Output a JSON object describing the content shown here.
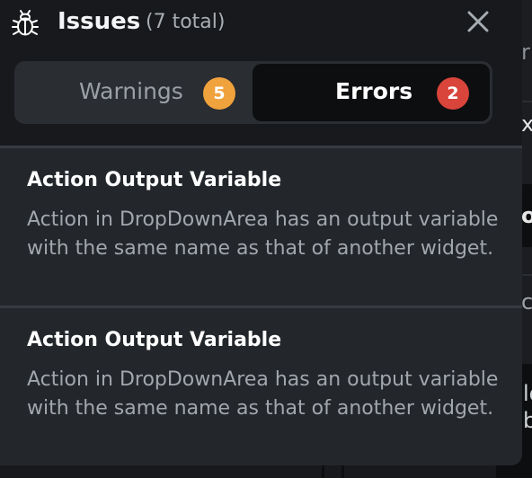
{
  "colors": {
    "warning_badge": "#f0a23c",
    "error_badge": "#d9443b",
    "panel": "#23262a",
    "header": "#17191c"
  },
  "header": {
    "icon": "bug-icon",
    "title": "Issues",
    "count": "(7 total)",
    "close_icon": "close-icon"
  },
  "tabs": [
    {
      "label": "Warnings",
      "badge": "5",
      "selected": false
    },
    {
      "label": "Errors",
      "badge": "2",
      "selected": true
    }
  ],
  "issues": [
    {
      "title": "Action Output Variable",
      "description": "Action in DropDownArea has an output variable with the same name as that of another widget."
    },
    {
      "title": "Action Output Variable",
      "description": "Action in DropDownArea has an output variable with the same name as that of another widget."
    }
  ]
}
